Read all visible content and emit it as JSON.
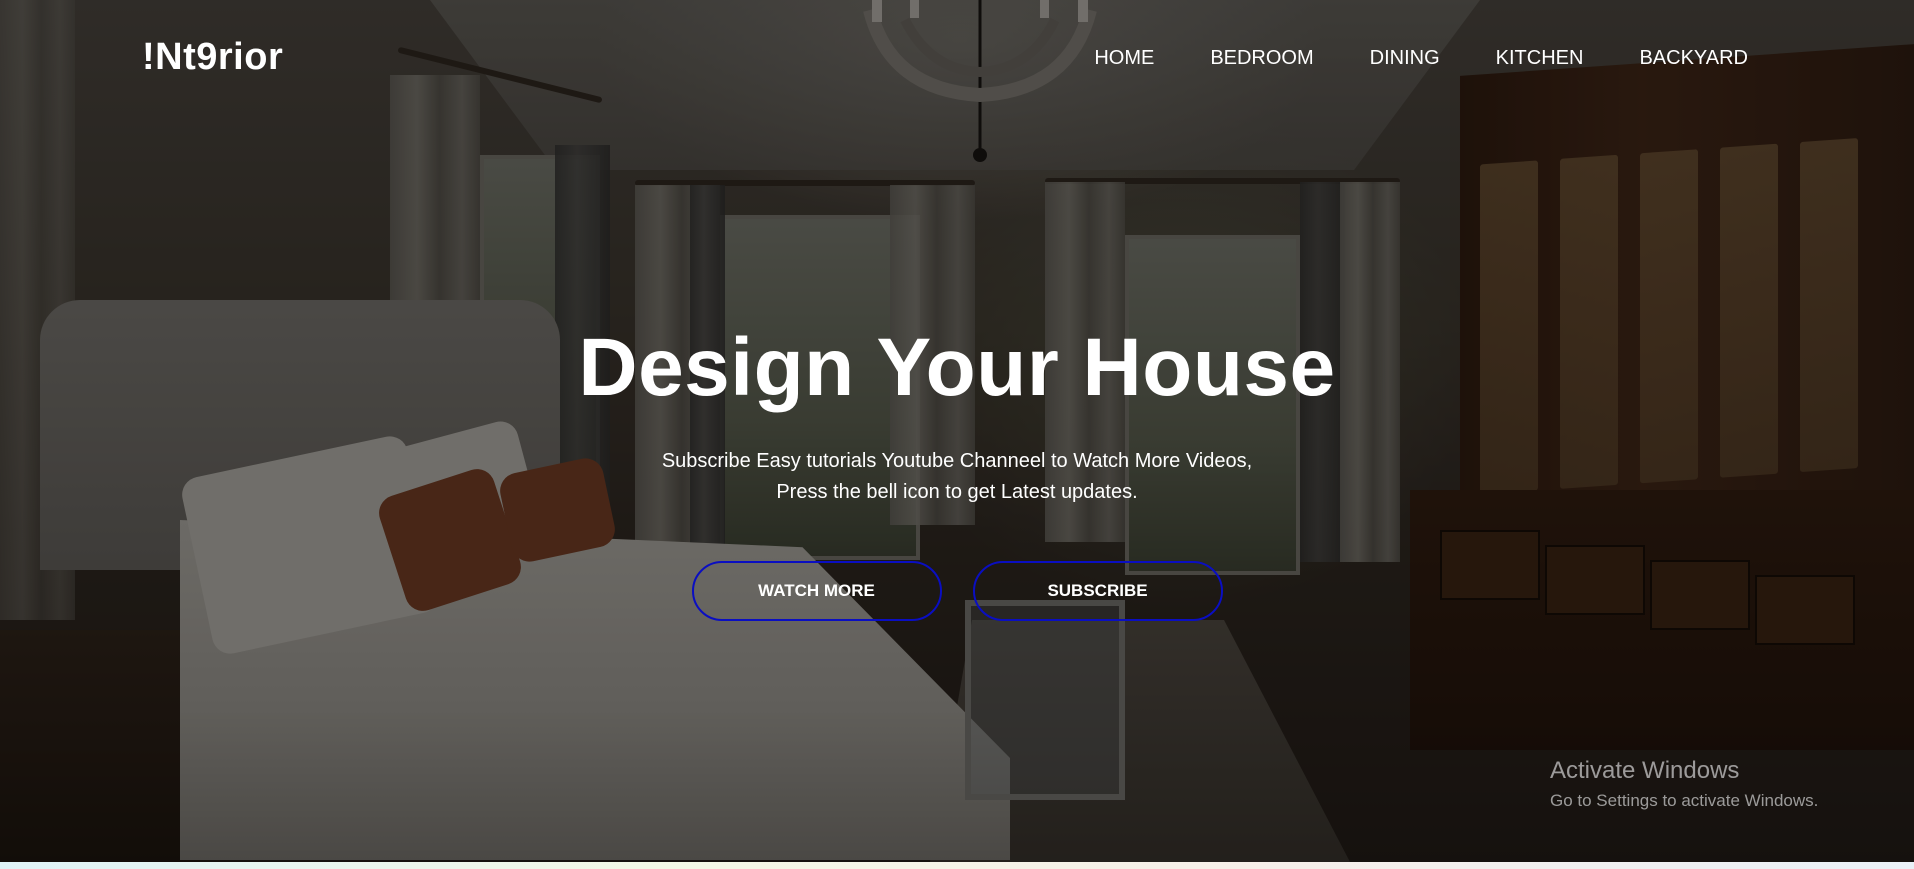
{
  "brand": {
    "logo_text": "!Nt9rior"
  },
  "nav": {
    "items": [
      {
        "label": "HOME"
      },
      {
        "label": "BEDROOM"
      },
      {
        "label": "DINING"
      },
      {
        "label": "KITCHEN"
      },
      {
        "label": "BACKYARD"
      }
    ]
  },
  "hero": {
    "title": "Design Your House",
    "subtitle_line1": "Subscribe Easy tutorials Youtube Channeel to Watch More Videos,",
    "subtitle_line2": "Press the bell icon to get Latest updates.",
    "buttons": {
      "watch_more": "WATCH MORE",
      "subscribe": "SUBSCRIBE"
    },
    "button_border_color": "#0a0ec2"
  },
  "watermark": {
    "line1": "Activate Windows",
    "line2": "Go to Settings to activate Windows."
  }
}
